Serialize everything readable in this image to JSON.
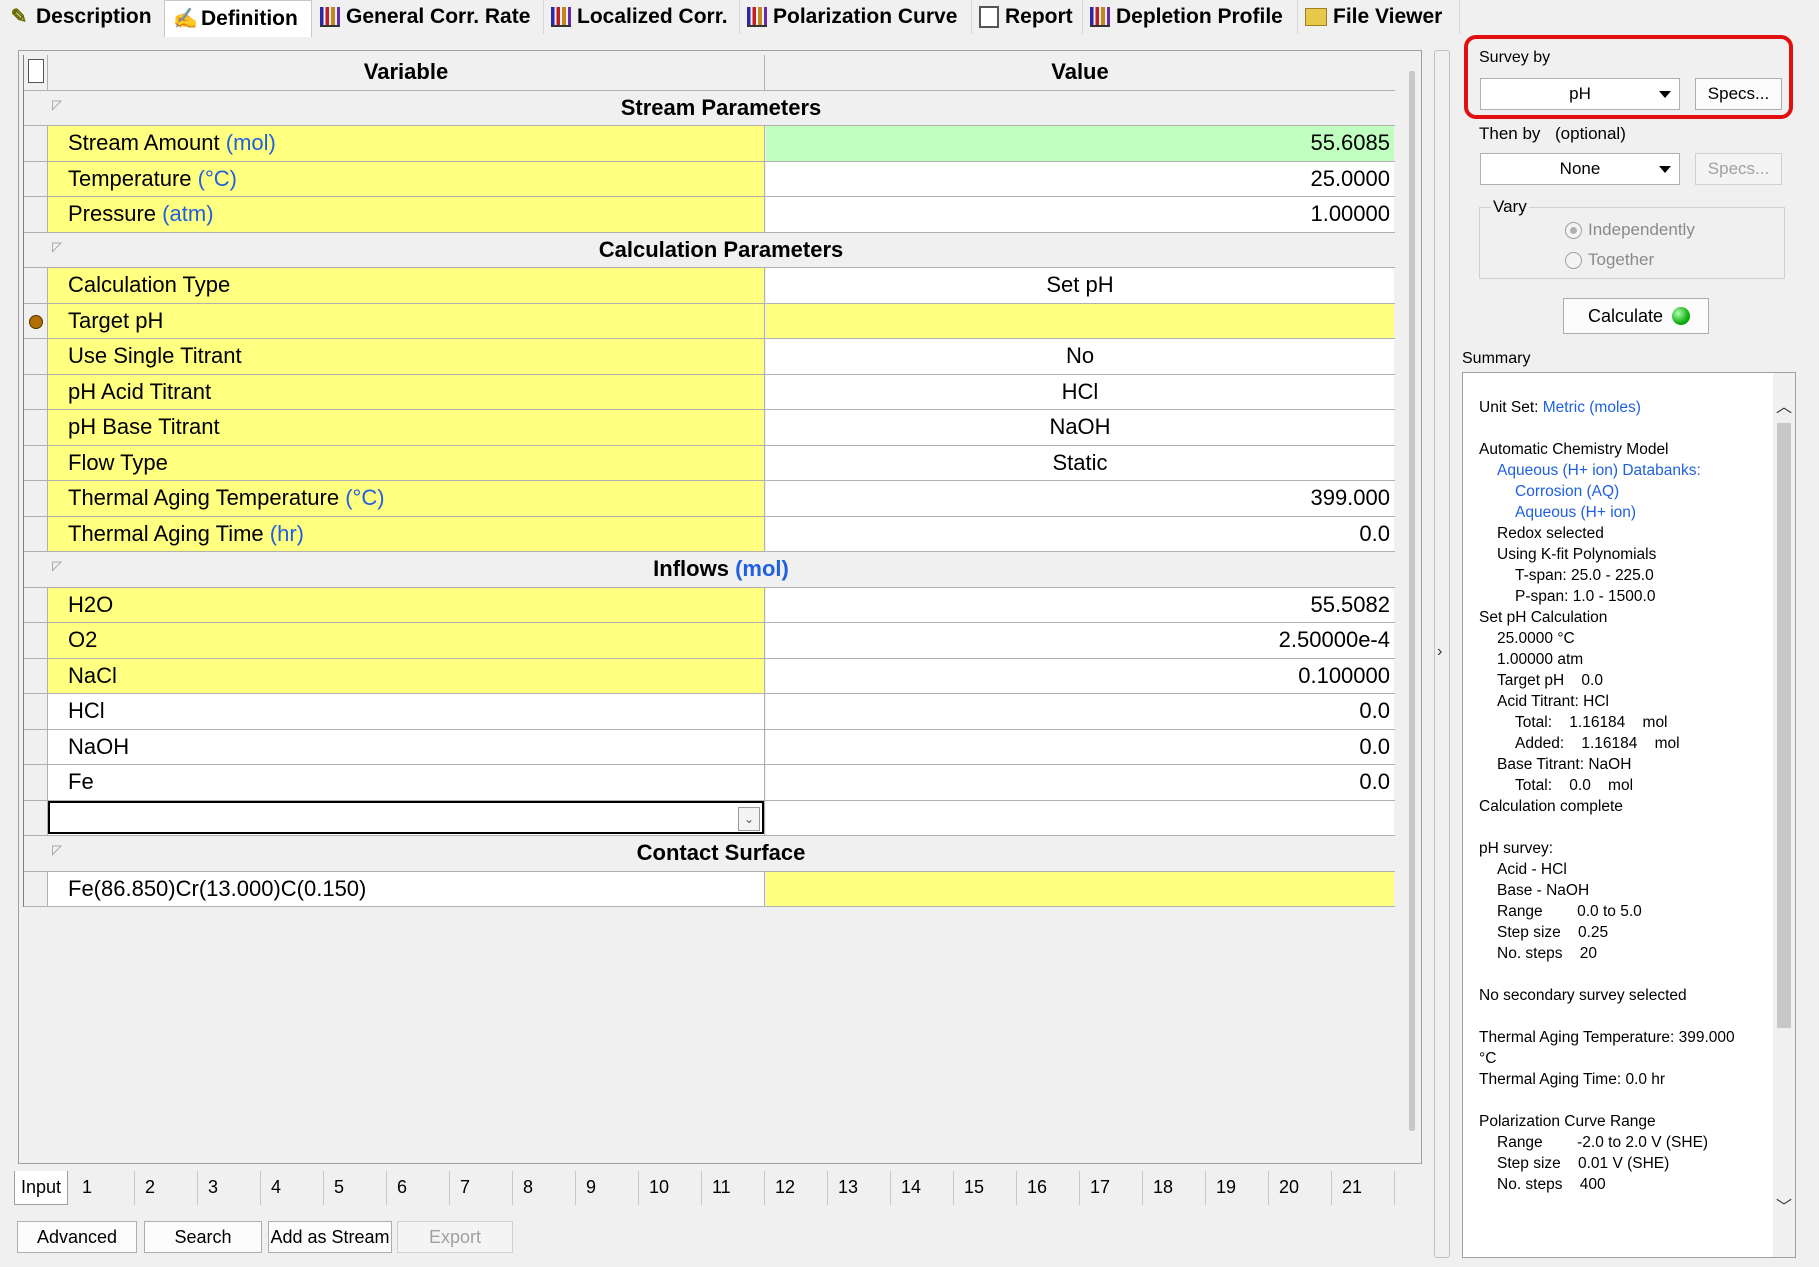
{
  "tabs": [
    {
      "label": "Description",
      "icon": "pencil-check-icon"
    },
    {
      "label": "Definition",
      "icon": "definition-icon"
    },
    {
      "label": "General Corr. Rate",
      "icon": "bar-chart-icon"
    },
    {
      "label": "Localized Corr.",
      "icon": "bar-chart-icon"
    },
    {
      "label": "Polarization Curve",
      "icon": "bar-chart-icon"
    },
    {
      "label": "Report",
      "icon": "report-icon"
    },
    {
      "label": "Depletion Profile",
      "icon": "bar-chart-icon"
    },
    {
      "label": "File Viewer",
      "icon": "folder-icon"
    }
  ],
  "grid": {
    "col_variable": "Variable",
    "col_value": "Value",
    "sections": {
      "stream": "Stream Parameters",
      "calc": "Calculation Parameters",
      "inflows": "Inflows",
      "inflows_unit": "mol",
      "contact": "Contact Surface"
    },
    "rows": {
      "stream_amount": {
        "label": "Stream Amount",
        "unit": "mol",
        "value": "55.6085"
      },
      "temperature": {
        "label": "Temperature",
        "unit": "°C",
        "value": "25.0000"
      },
      "pressure": {
        "label": "Pressure",
        "unit": "atm",
        "value": "1.00000"
      },
      "calc_type": {
        "label": "Calculation Type",
        "value": "Set pH"
      },
      "target_ph": {
        "label": "Target pH",
        "value": ""
      },
      "single_titrant": {
        "label": "Use Single Titrant",
        "value": "No"
      },
      "acid_titrant": {
        "label": "pH Acid Titrant",
        "value": "HCl"
      },
      "base_titrant": {
        "label": "pH Base Titrant",
        "value": "NaOH"
      },
      "flow_type": {
        "label": "Flow Type",
        "value": "Static"
      },
      "aging_temp": {
        "label": "Thermal Aging Temperature",
        "unit": "°C",
        "value": "399.000"
      },
      "aging_time": {
        "label": "Thermal Aging Time",
        "unit": "hr",
        "value": "0.0"
      },
      "h2o": {
        "label": "H2O",
        "value": "55.5082"
      },
      "o2": {
        "label": "O2",
        "value": "2.50000e-4"
      },
      "nacl": {
        "label": "NaCl",
        "value": "0.100000"
      },
      "hcl": {
        "label": "HCl",
        "value": "0.0"
      },
      "naoh": {
        "label": "NaOH",
        "value": "0.0"
      },
      "fe": {
        "label": "Fe",
        "value": "0.0"
      },
      "surface": {
        "label": "Fe(86.850)Cr(13.000)C(0.150)",
        "value": ""
      }
    }
  },
  "subtabs": [
    "Input",
    "1",
    "2",
    "3",
    "4",
    "5",
    "6",
    "7",
    "8",
    "9",
    "10",
    "11",
    "12",
    "13",
    "14",
    "15",
    "16",
    "17",
    "18",
    "19",
    "20",
    "21"
  ],
  "buttons": {
    "advanced": "Advanced",
    "search": "Search",
    "add_stream": "Add as Stream",
    "export": "Export"
  },
  "survey": {
    "survey_by_label": "Survey by",
    "survey_by_value": "pH",
    "specs": "Specs...",
    "then_by_label": "Then by",
    "then_by_optional": "(optional)",
    "then_by_value": "None",
    "vary_label": "Vary",
    "independently": "Independently",
    "together": "Together",
    "calculate": "Calculate"
  },
  "summary": {
    "title": "Summary",
    "lines": [
      {
        "t": "Unit Set: ",
        "b": "Metric (moles)",
        "i": 0
      },
      {
        "t": "",
        "i": 0
      },
      {
        "t": "Automatic Chemistry Model",
        "i": 0
      },
      {
        "b": "Aqueous (H+ ion) Databanks:",
        "i": 1
      },
      {
        "b": "Corrosion (AQ)",
        "i": 2
      },
      {
        "b": "Aqueous (H+ ion)",
        "i": 2
      },
      {
        "t": "Redox selected",
        "i": 1
      },
      {
        "t": "Using K-fit Polynomials",
        "i": 1
      },
      {
        "t": "T-span: 25.0 - 225.0",
        "i": 2
      },
      {
        "t": "P-span: 1.0 - 1500.0",
        "i": 2
      },
      {
        "t": "Set pH Calculation",
        "i": 0
      },
      {
        "t": "25.0000 °C",
        "i": 1
      },
      {
        "t": "1.00000 atm",
        "i": 1
      },
      {
        "t": "Target pH    0.0",
        "i": 1
      },
      {
        "t": "Acid Titrant: HCl",
        "i": 1
      },
      {
        "t": "Total:    1.16184    mol",
        "i": 2
      },
      {
        "t": "Added:    1.16184    mol",
        "i": 2
      },
      {
        "t": "Base Titrant: NaOH",
        "i": 1
      },
      {
        "t": "Total:    0.0    mol",
        "i": 2
      },
      {
        "t": "Calculation complete",
        "i": 0
      },
      {
        "t": "",
        "i": 0
      },
      {
        "t": "pH survey:",
        "i": 0
      },
      {
        "t": "Acid - HCl",
        "i": 1
      },
      {
        "t": "Base - NaOH",
        "i": 1
      },
      {
        "t": "Range        0.0 to 5.0",
        "i": 1
      },
      {
        "t": "Step size    0.25",
        "i": 1
      },
      {
        "t": "No. steps    20",
        "i": 1
      },
      {
        "t": "",
        "i": 0
      },
      {
        "t": "No secondary survey selected",
        "i": 0
      },
      {
        "t": "",
        "i": 0
      },
      {
        "t": "Thermal Aging Temperature: 399.000",
        "i": 0
      },
      {
        "t": "°C",
        "i": 0
      },
      {
        "t": "Thermal Aging Time: 0.0 hr",
        "i": 0
      },
      {
        "t": "",
        "i": 0
      },
      {
        "t": "Polarization Curve Range",
        "i": 0
      },
      {
        "t": "Range        -2.0 to 2.0 V (SHE)",
        "i": 1
      },
      {
        "t": "Step size    0.01 V (SHE)",
        "i": 1
      },
      {
        "t": "No. steps    400",
        "i": 1
      }
    ]
  }
}
